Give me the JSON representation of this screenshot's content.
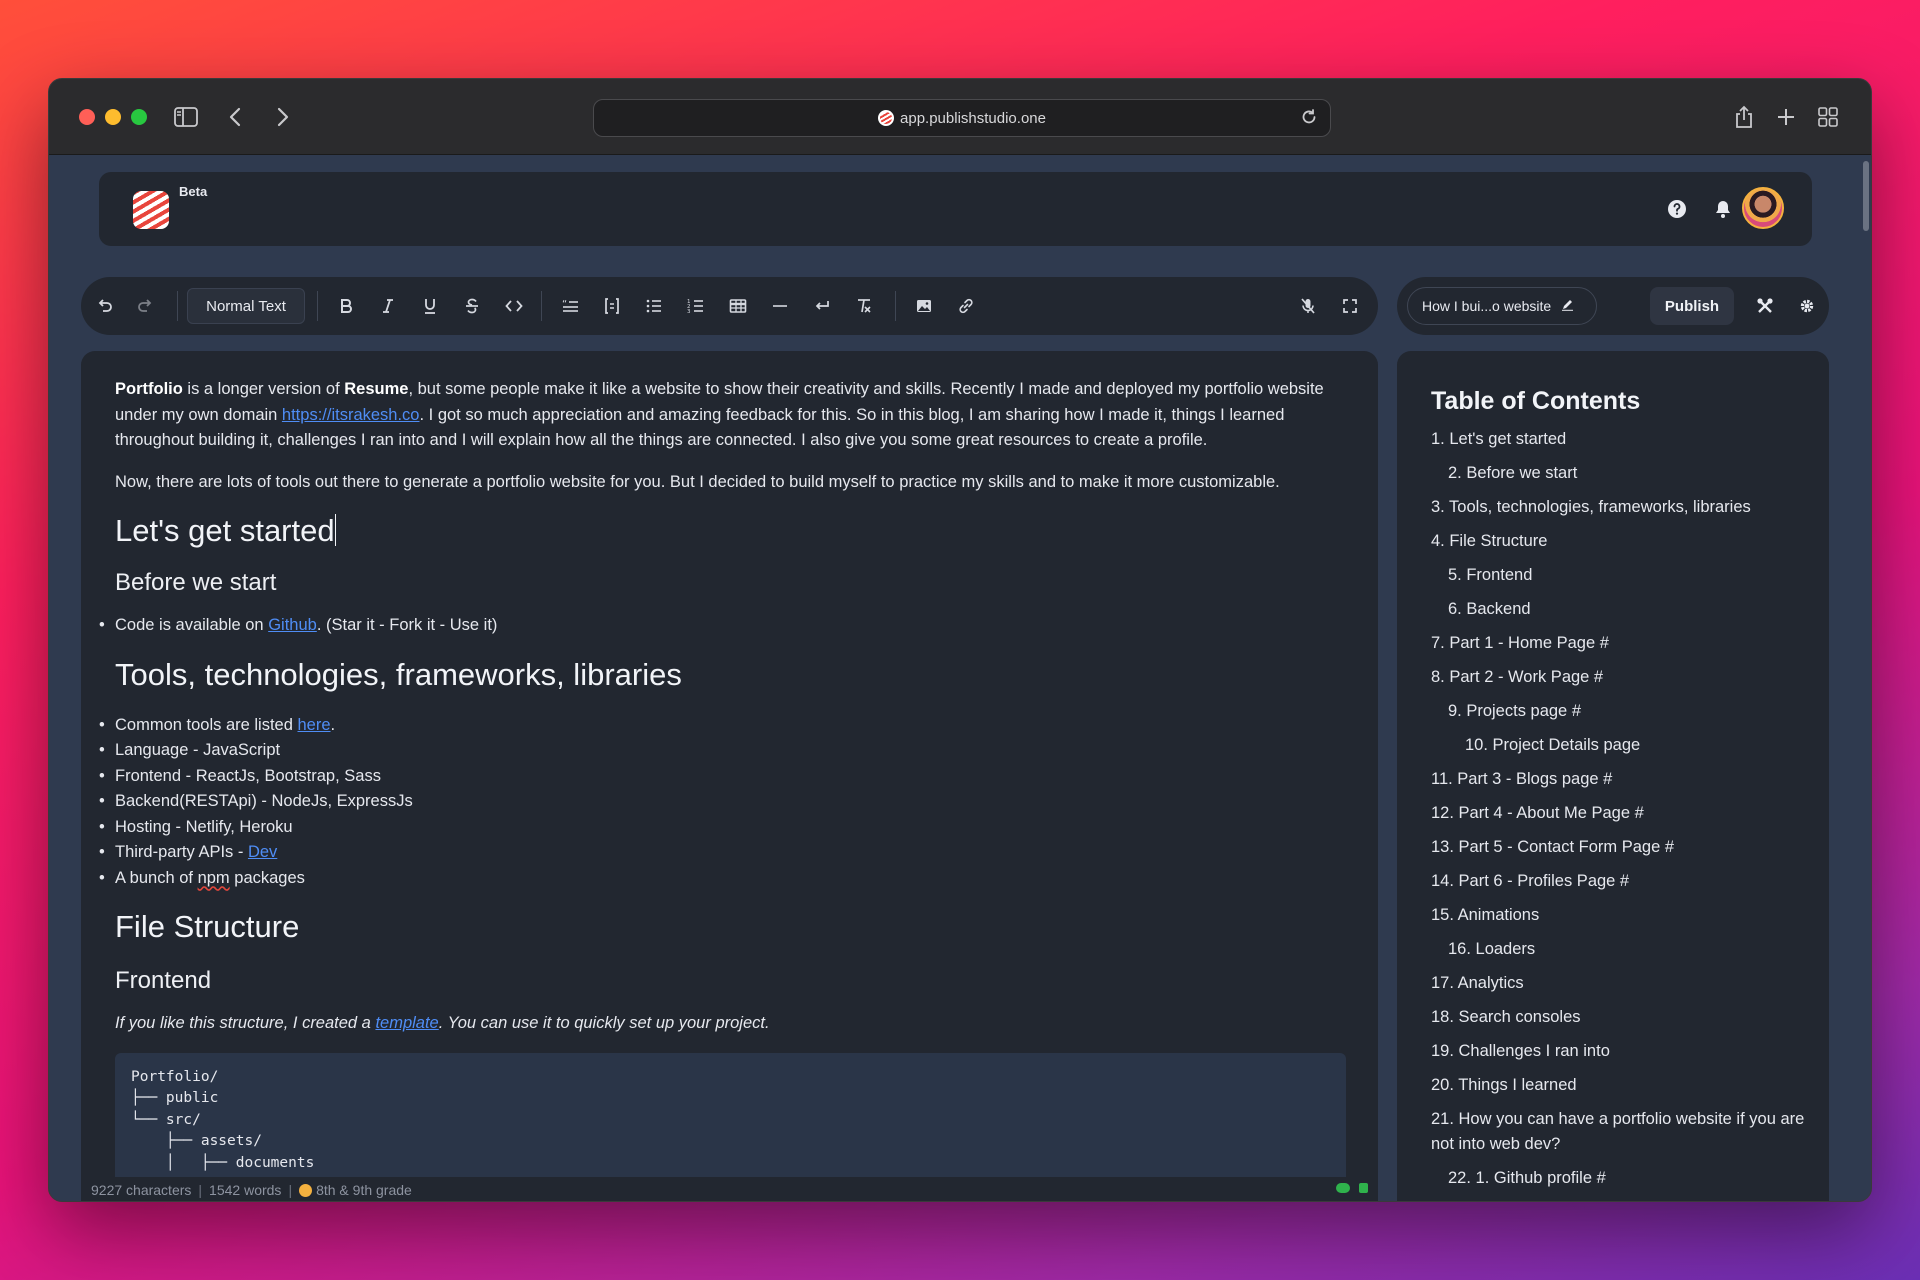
{
  "browser": {
    "url": "app.publishstudio.one"
  },
  "header": {
    "badge": "Beta"
  },
  "toolbar": {
    "text_style": "Normal Text"
  },
  "publish_bar": {
    "doc_title": "How I bui...o website",
    "publish_label": "Publish"
  },
  "editor": {
    "p1": {
      "b1": "Portfolio",
      "t1": " is a longer version of ",
      "b2": "Resume",
      "t2": ", but some people make it like a website to show their creativity and skills. Recently I made and deployed my portfolio website under my own domain ",
      "link": "https://itsrakesh.co",
      "t3": ". I got so much appreciation and amazing feedback for this. So in this blog, I am sharing how I made it, things I learned throughout building it, challenges I ran into and I will explain how all the things are connected. I also give you some great resources to create a profile."
    },
    "p2": "Now, there are lots of tools out there to generate a portfolio website for you. But I decided to build myself to practice my skills and to make it more customizable.",
    "h_started": "Let's get started",
    "h_before": "Before we start",
    "before_item": {
      "t1": "Code is available on ",
      "link": "Github",
      "t2": ". (Star it - Fork it - Use it)"
    },
    "h_tools": "Tools, technologies, frameworks, libraries",
    "tools": {
      "i1_t": "Common tools are listed ",
      "i1_link": "here",
      "i1_end": ".",
      "i2": "Language - JavaScript",
      "i3": "Frontend - ReactJs, Bootstrap, Sass",
      "i4": "Backend(RESTApi) - NodeJs, ExpressJs",
      "i5": "Hosting - Netlify, Heroku",
      "i6_t": "Third-party APIs - ",
      "i6_link": "Dev",
      "i7_a": "A bunch of ",
      "i7_spell": "npm",
      "i7_b": " packages"
    },
    "h_file": "File Structure",
    "h_frontend": "Frontend",
    "frontend_note": {
      "t1": "If you like this structure, I created a ",
      "link": "template",
      "t2": ". You can use it to quickly set up your project."
    },
    "code": "Portfolio/\n├── public\n└── src/\n    ├── assets/\n    │   ├── documents"
  },
  "status": {
    "characters": "9227 characters",
    "words": "1542 words",
    "grade": "8th & 9th grade"
  },
  "toc": {
    "title": "Table of Contents",
    "items": [
      {
        "label": "1. Let's get started",
        "level": 1
      },
      {
        "label": "2. Before we start",
        "level": 2
      },
      {
        "label": "3. Tools, technologies, frameworks, libraries",
        "level": 1
      },
      {
        "label": "4. File Structure",
        "level": 1
      },
      {
        "label": "5. Frontend",
        "level": 2
      },
      {
        "label": "6. Backend",
        "level": 2
      },
      {
        "label": "7. Part 1 - Home Page #",
        "level": 1
      },
      {
        "label": "8. Part 2 - Work Page #",
        "level": 1
      },
      {
        "label": "9. Projects page #",
        "level": 2
      },
      {
        "label": "10. Project Details page",
        "level": 3
      },
      {
        "label": "11. Part 3 - Blogs page #",
        "level": 1
      },
      {
        "label": "12. Part 4 - About Me Page #",
        "level": 1
      },
      {
        "label": "13. Part 5 - Contact Form Page #",
        "level": 1
      },
      {
        "label": "14. Part 6 - Profiles Page #",
        "level": 1
      },
      {
        "label": "15. Animations",
        "level": 1
      },
      {
        "label": "16. Loaders",
        "level": 2
      },
      {
        "label": "17. Analytics",
        "level": 1
      },
      {
        "label": "18. Search consoles",
        "level": 1
      },
      {
        "label": "19. Challenges I ran into",
        "level": 1
      },
      {
        "label": "20. Things I learned",
        "level": 1
      },
      {
        "label": "21. How you can have a portfolio website if you are not into web dev?",
        "level": 1
      },
      {
        "label": "22. 1. Github profile #",
        "level": 2
      }
    ]
  },
  "icons": {
    "back": "chevron-left-icon",
    "forward": "chevron-right-icon",
    "sidebar": "sidebar-icon",
    "share": "share-icon",
    "new_tab": "plus-icon",
    "tabs": "grid-icon",
    "reload": "reload-icon",
    "help": "help-icon",
    "bell": "bell-icon"
  },
  "colors": {
    "accent_link": "#4f8df5",
    "editor_bg": "#222730",
    "window_bg": "#2f3a4f",
    "status_green": "#2fb24c"
  }
}
